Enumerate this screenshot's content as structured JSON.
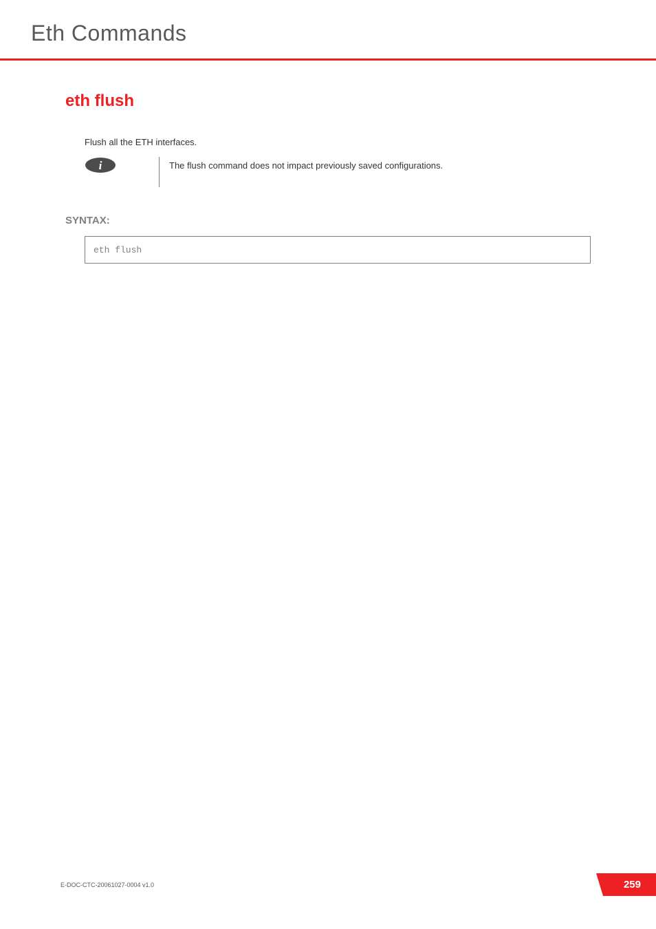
{
  "header": {
    "title": "Eth Commands"
  },
  "command": {
    "title": "eth flush",
    "description": "Flush all the ETH interfaces.",
    "info_note": "The flush command does not impact previously saved configurations."
  },
  "syntax": {
    "label": "SYNTAX:",
    "code": "eth flush"
  },
  "footer": {
    "doc_id": "E-DOC-CTC-20061027-0004 v1.0",
    "page_number": "259"
  }
}
